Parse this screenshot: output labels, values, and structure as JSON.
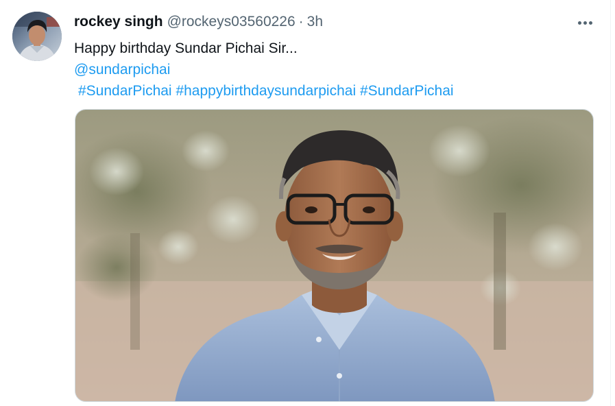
{
  "tweet": {
    "author": {
      "display_name": "rockey singh",
      "handle": "@rockeys03560226"
    },
    "separator": "·",
    "time": "3h",
    "text_line": "Happy birthday Sundar Pichai Sir...",
    "mention": "@sundarpichai",
    "hashtags": [
      "#SundarPichai",
      "#happybirthdaysundarpichai",
      "#SundarPichai"
    ],
    "more_icon": "more-horizontal-icon"
  },
  "colors": {
    "link": "#1d9bf0",
    "text_primary": "#0f1419",
    "text_secondary": "#536471",
    "border": "#cfd9de"
  }
}
